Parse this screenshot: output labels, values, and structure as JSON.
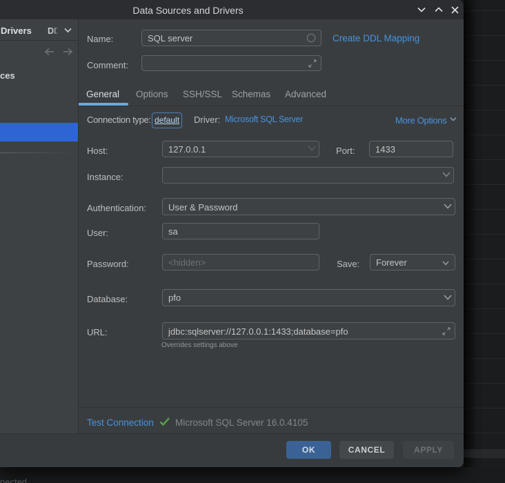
{
  "window": {
    "title": "Data Sources and Drivers",
    "controls": {
      "minimize": "chevron-down",
      "maximize": "chevron-up",
      "close": "x"
    }
  },
  "left_panel": {
    "header_primary": "Drivers",
    "header_secondary": "DD",
    "header_sliver": "s",
    "tree_item_fragment": "ces"
  },
  "form": {
    "name": {
      "label": "Name:",
      "value": "SQL server"
    },
    "create_ddl_mapping": "Create DDL Mapping",
    "comment": {
      "label": "Comment:",
      "value": ""
    },
    "tabs": [
      "General",
      "Options",
      "SSH/SSL",
      "Schemas",
      "Advanced"
    ],
    "active_tab": "General",
    "connection_type": {
      "label": "Connection type:",
      "value": "default"
    },
    "driver": {
      "label": "Driver:",
      "value": "Microsoft SQL Server"
    },
    "more_options": "More Options",
    "host": {
      "label": "Host:",
      "value": "127.0.0.1"
    },
    "port": {
      "label": "Port:",
      "value": "1433"
    },
    "instance": {
      "label": "Instance:",
      "value": ""
    },
    "authentication": {
      "label": "Authentication:",
      "value": "User & Password"
    },
    "user": {
      "label": "User:",
      "value": "sa"
    },
    "password": {
      "label": "Password:",
      "placeholder": "<hidden>"
    },
    "save": {
      "label": "Save:",
      "value": "Forever"
    },
    "database": {
      "label": "Database:",
      "value": "pfo"
    },
    "url": {
      "label": "URL:",
      "value": "jdbc:sqlserver://127.0.0.1:1433;database=pfo"
    },
    "url_hint": "Overrides settings above"
  },
  "test": {
    "link": "Test Connection",
    "result": "Microsoft SQL Server 16.0.4105"
  },
  "footer": {
    "ok": "OK",
    "cancel": "CANCEL",
    "apply": "APPLY"
  },
  "status_bar": {
    "fragment": "nected"
  },
  "colors": {
    "dialog_bg": "#3a3d3f",
    "left_panel_bg": "#3e4144",
    "titlebar_bg": "#2b2d30",
    "selection_blue": "#2e65d4",
    "link_blue": "#4793e0",
    "tab_underline": "#6aa9e0",
    "ok_button": "#3a6295",
    "check_green": "#57a64a",
    "editor_bg": "#1b1c1d"
  }
}
